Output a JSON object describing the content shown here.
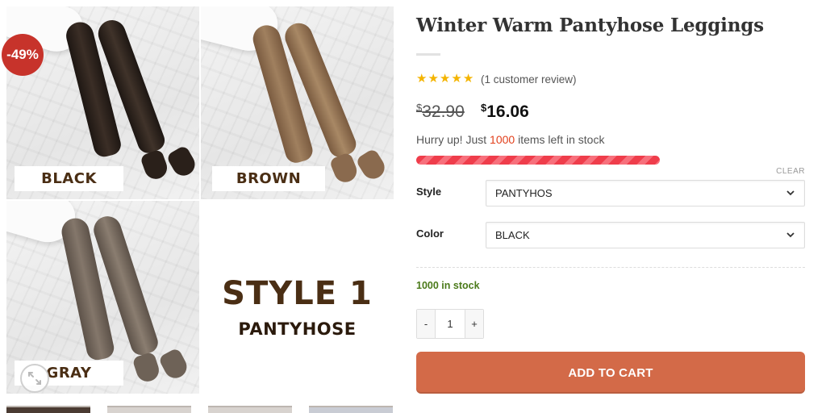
{
  "gallery": {
    "sale_badge": "-49%",
    "tiles": [
      {
        "label": "BLACK"
      },
      {
        "label": "BROWN"
      },
      {
        "label": "GRAY"
      }
    ],
    "style_heading": "STYLE 1",
    "style_sub": "PANTYHOSE",
    "colors": {
      "black": "#2a211c",
      "brown": "#8a6a4e",
      "gray": "#6e6257"
    }
  },
  "product": {
    "title": "Winter Warm Pantyhose Leggings",
    "rating_stars": 5,
    "review_text": "(1 customer review)",
    "currency": "$",
    "price_old": "32.90",
    "price_new": "16.06",
    "hurry_prefix": "Hurry up! Just ",
    "hurry_count": "1000",
    "hurry_suffix": " items left in stock",
    "clear_label": "CLEAR",
    "variations": [
      {
        "label": "Style",
        "value": "PANTYHOS"
      },
      {
        "label": "Color",
        "value": "BLACK"
      }
    ],
    "in_stock": "1000 in stock",
    "qty": {
      "minus": "-",
      "value": "1",
      "plus": "+"
    },
    "add_to_cart": "ADD TO CART",
    "accent": "#d36a48",
    "sale_color": "#c7332b"
  }
}
